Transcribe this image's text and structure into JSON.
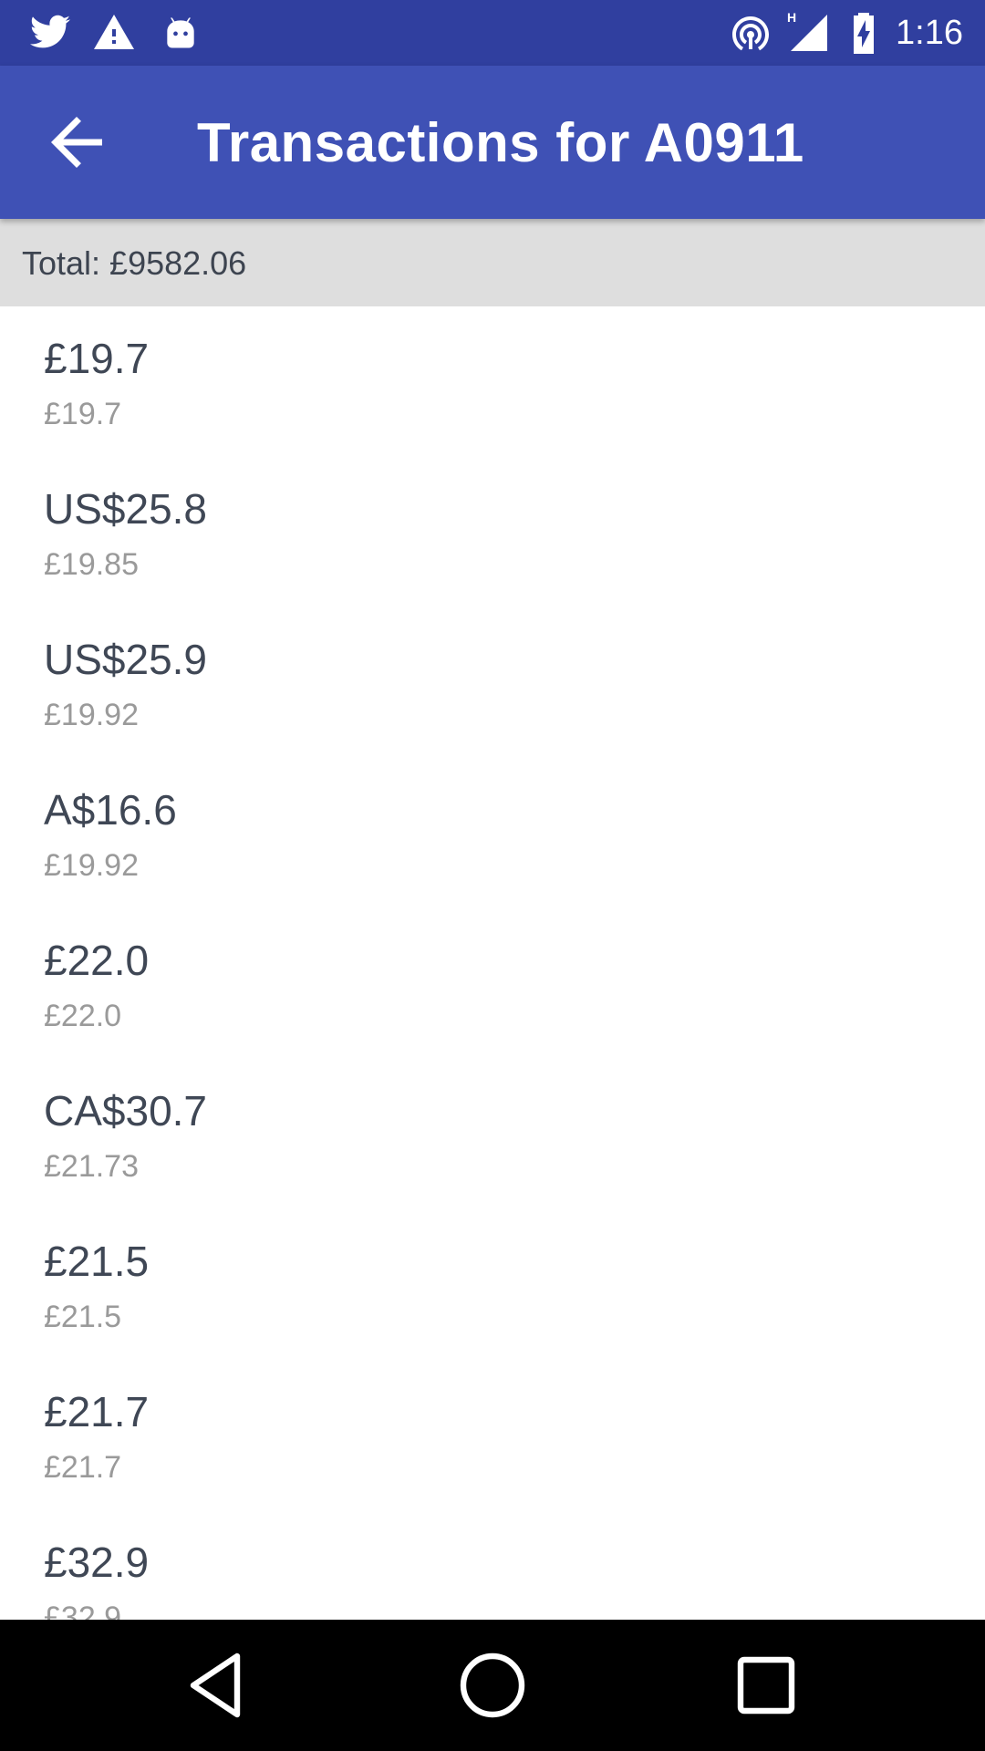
{
  "status_bar": {
    "time": "1:16",
    "icons": [
      "twitter-icon",
      "warning-icon",
      "android-icon",
      "hotspot-icon",
      "signal-icon",
      "battery-icon"
    ]
  },
  "app_bar": {
    "title": "Transactions for A0911",
    "back_icon": "arrow-back-icon",
    "color": "#3f51b5"
  },
  "summary": {
    "total": "Total: £9582.06"
  },
  "transactions": [
    {
      "amount": "£19.7",
      "converted": "£19.7"
    },
    {
      "amount": "US$25.8",
      "converted": "£19.85"
    },
    {
      "amount": "US$25.9",
      "converted": "£19.92"
    },
    {
      "amount": "A$16.6",
      "converted": "£19.92"
    },
    {
      "amount": "£22.0",
      "converted": "£22.0"
    },
    {
      "amount": "CA$30.7",
      "converted": "£21.73"
    },
    {
      "amount": "£21.5",
      "converted": "£21.5"
    },
    {
      "amount": "£21.7",
      "converted": "£21.7"
    },
    {
      "amount": "£32.9",
      "converted": "£32.9"
    }
  ],
  "nav_bar": {
    "icons": [
      "back-triangle-icon",
      "home-circle-icon",
      "recents-square-icon"
    ]
  }
}
